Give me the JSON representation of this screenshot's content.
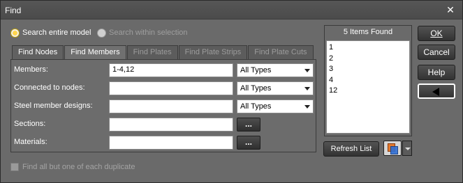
{
  "window": {
    "title": "Find"
  },
  "search_scope": {
    "entire_model_label": "Search entire model",
    "within_selection_label": "Search within selection",
    "selected": "entire_model"
  },
  "tabs": [
    {
      "label": "Find Nodes",
      "state": "enabled"
    },
    {
      "label": "Find Members",
      "state": "active"
    },
    {
      "label": "Find Plates",
      "state": "disabled"
    },
    {
      "label": "Find Plate Strips",
      "state": "disabled"
    },
    {
      "label": "Find Plate Cuts",
      "state": "disabled"
    }
  ],
  "form": {
    "members": {
      "label": "Members:",
      "value": "1-4,12",
      "type": "All Types"
    },
    "connected_nodes": {
      "label": "Connected to nodes:",
      "value": "",
      "type": "All Types"
    },
    "steel_designs": {
      "label": "Steel member designs:",
      "value": "",
      "type": "All Types"
    },
    "sections": {
      "label": "Sections:",
      "value": "",
      "button": "..."
    },
    "materials": {
      "label": "Materials:",
      "value": "",
      "button": "..."
    }
  },
  "duplicate_option": {
    "label": "Find all but one of each duplicate",
    "checked": false,
    "enabled": false
  },
  "results": {
    "header": "5 Items Found",
    "items": [
      "1",
      "2",
      "3",
      "4",
      "12"
    ]
  },
  "buttons": {
    "ok": "OK",
    "cancel": "Cancel",
    "help": "Help",
    "refresh": "Refresh List"
  },
  "icons": {
    "close": "close-icon",
    "back": "back-arrow-icon",
    "copy": "copy-to-clipboard-icon",
    "dropdown": "chevron-down-icon"
  },
  "colors": {
    "dialog_bg": "#6a6a6a",
    "radio_selected": "#ffd54a",
    "copy_orange": "#e27a2f",
    "copy_blue": "#2f6fd6"
  }
}
